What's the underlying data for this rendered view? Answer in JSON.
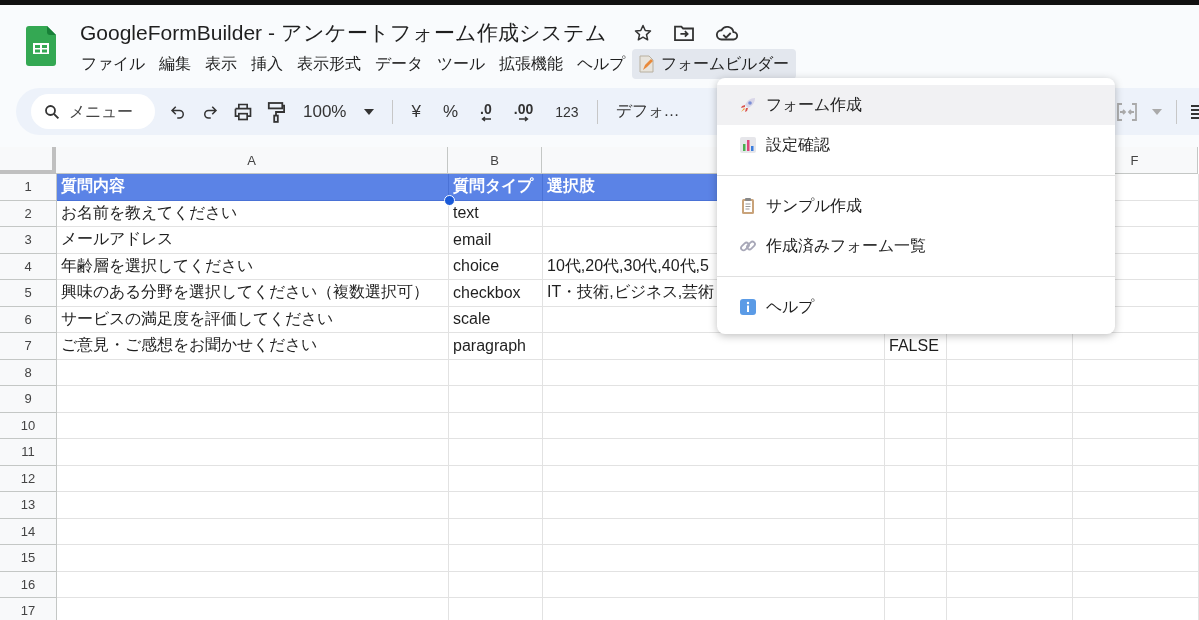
{
  "document": {
    "title": "GoogleFormBuilder - アンケートフォーム作成システム"
  },
  "menu_bar": [
    {
      "label": "ファイル",
      "open": false
    },
    {
      "label": "編集",
      "open": false
    },
    {
      "label": "表示",
      "open": false
    },
    {
      "label": "挿入",
      "open": false
    },
    {
      "label": "表示形式",
      "open": false
    },
    {
      "label": "データ",
      "open": false
    },
    {
      "label": "ツール",
      "open": false
    },
    {
      "label": "拡張機能",
      "open": false
    },
    {
      "label": "ヘルプ",
      "open": false
    },
    {
      "label": "フォームビルダー",
      "open": true
    }
  ],
  "toolbar": {
    "search_placeholder": "メニュー",
    "zoom": "100%",
    "currency": "¥",
    "percent": "%",
    "decrease_decimals": ".0",
    "increase_decimals": ".00",
    "number_format": "123",
    "font": "デフォ…"
  },
  "dropdown": [
    [
      {
        "label": "フォーム作成",
        "kind": "rocket",
        "selected": true
      },
      {
        "label": "設定確認",
        "kind": "chart",
        "selected": false
      }
    ],
    [
      {
        "label": "サンプル作成",
        "kind": "clipboard",
        "selected": false
      },
      {
        "label": "作成済みフォーム一覧",
        "kind": "link",
        "selected": false
      }
    ],
    [
      {
        "label": "ヘルプ",
        "kind": "info",
        "selected": false
      }
    ]
  ],
  "columns": [
    {
      "letter": "A"
    },
    {
      "letter": "B"
    },
    {},
    {},
    {},
    {
      "letter": "F"
    }
  ],
  "rows": [
    {
      "number": "1",
      "header": true,
      "cells": [
        "質問内容",
        "質問タイプ",
        "選択肢",
        null,
        null,
        null
      ]
    },
    {
      "number": "2",
      "header": false,
      "cells": [
        "お名前を教えてください",
        "text",
        null,
        null,
        null,
        null
      ]
    },
    {
      "number": "3",
      "header": false,
      "cells": [
        "メールアドレス",
        "email",
        null,
        null,
        null,
        null
      ]
    },
    {
      "number": "4",
      "header": false,
      "cells": [
        "年齢層を選択してください",
        "choice",
        "10代,20代,30代,40代,5",
        null,
        null,
        null
      ]
    },
    {
      "number": "5",
      "header": false,
      "cells": [
        "興味のある分野を選択してください（複数選択可）",
        "checkbox",
        "IT・技術,ビジネス,芸術",
        null,
        null,
        null
      ]
    },
    {
      "number": "6",
      "header": false,
      "cells": [
        "サービスの満足度を評価してください",
        "scale",
        null,
        null,
        null,
        null
      ]
    },
    {
      "number": "7",
      "header": false,
      "cells": [
        "ご意見・ご感想をお聞かせください",
        "paragraph",
        null,
        "FALSE",
        null,
        null
      ]
    },
    {
      "number": "8",
      "header": false,
      "cells": [
        null,
        null,
        null,
        null,
        null,
        null
      ]
    },
    {
      "number": "9",
      "header": false,
      "cells": [
        null,
        null,
        null,
        null,
        null,
        null
      ]
    },
    {
      "number": "10",
      "header": false,
      "cells": [
        null,
        null,
        null,
        null,
        null,
        null
      ]
    },
    {
      "number": "11",
      "header": false,
      "cells": [
        null,
        null,
        null,
        null,
        null,
        null
      ]
    },
    {
      "number": "12",
      "header": false,
      "cells": [
        null,
        null,
        null,
        null,
        null,
        null
      ]
    },
    {
      "number": "13",
      "header": false,
      "cells": [
        null,
        null,
        null,
        null,
        null,
        null
      ]
    },
    {
      "number": "14",
      "header": false,
      "cells": [
        null,
        null,
        null,
        null,
        null,
        null
      ]
    },
    {
      "number": "15",
      "header": false,
      "cells": [
        null,
        null,
        null,
        null,
        null,
        null
      ]
    },
    {
      "number": "16",
      "header": false,
      "cells": [
        null,
        null,
        null,
        null,
        null,
        null
      ]
    },
    {
      "number": "17",
      "header": false,
      "cells": [
        null,
        null,
        null,
        null,
        null,
        null
      ]
    }
  ]
}
